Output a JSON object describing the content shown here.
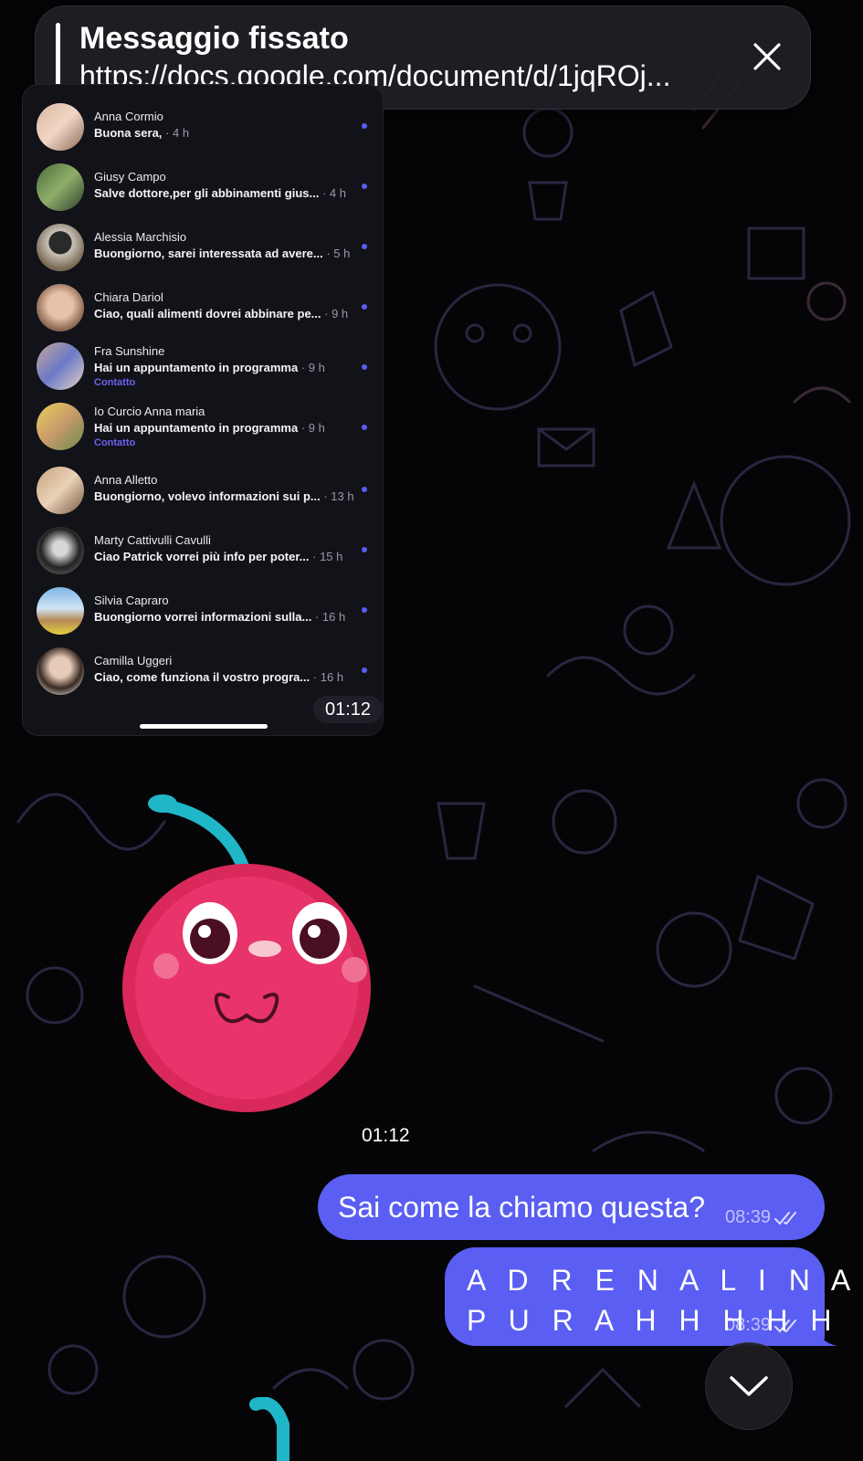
{
  "pinned": {
    "title": "Messaggio fissato",
    "link": "https://docs.google.com/document/d/1jqROj..."
  },
  "shot": {
    "rows": [
      {
        "name": "Anna Cormio",
        "preview": "Buona sera,",
        "time": "· 4 h",
        "contact": ""
      },
      {
        "name": "Giusy Campo",
        "preview": "Salve dottore,per gli abbinamenti gius...",
        "time": "· 4 h",
        "contact": ""
      },
      {
        "name": "Alessia Marchisio",
        "preview": "Buongiorno, sarei interessata ad avere...",
        "time": "· 5 h",
        "contact": ""
      },
      {
        "name": "Chiara Dariol",
        "preview": "Ciao, quali alimenti dovrei abbinare pe...",
        "time": "· 9 h",
        "contact": ""
      },
      {
        "name": "Fra Sunshine",
        "preview": "Hai un appuntamento in programma",
        "time": "· 9 h",
        "contact": "Contatto"
      },
      {
        "name": "Io Curcio Anna maria",
        "preview": "Hai un appuntamento in programma",
        "time": "· 9 h",
        "contact": "Contatto"
      },
      {
        "name": "Anna Alletto",
        "preview": "Buongiorno, volevo informazioni sui p...",
        "time": "· 13 h",
        "contact": ""
      },
      {
        "name": "Marty Cattivulli Cavulli",
        "preview": "Ciao Patrick vorrei più  info per poter...",
        "time": "· 15 h",
        "contact": ""
      },
      {
        "name": "Silvia Capraro",
        "preview": "Buongiorno vorrei informazioni sulla...",
        "time": "· 16 h",
        "contact": ""
      },
      {
        "name": "Camilla Uggeri",
        "preview": "Ciao, come funziona il vostro progra...",
        "time": "· 16 h",
        "contact": ""
      }
    ],
    "time": "01:12"
  },
  "sticker": {
    "time": "01:12"
  },
  "messages": [
    {
      "text": "Sai come la chiamo questa?",
      "time": "08:39"
    },
    {
      "line1": "A D R E N A L I N A",
      "line2": "P U R A H H H H H",
      "time": "08:39"
    }
  ],
  "colors": {
    "accent": "#5b5ef2",
    "background": "#050507",
    "contact_label": "#6b63f0"
  },
  "icons": {
    "close": "close-icon",
    "scroll_down": "chevron-down-icon",
    "read": "double-check-icon"
  }
}
